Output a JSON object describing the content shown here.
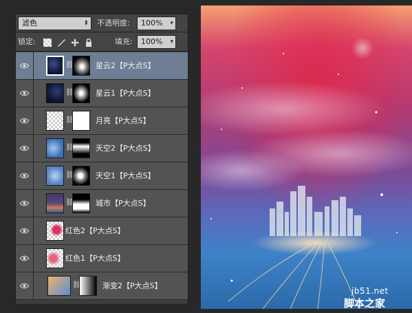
{
  "blend_mode": {
    "value": "滤色"
  },
  "opacity": {
    "label": "不透明度:",
    "value": "100%"
  },
  "lock": {
    "label": "锁定:"
  },
  "fill": {
    "label": "填充:",
    "value": "100%"
  },
  "layers": [
    {
      "name": "星云2【P大点S】",
      "selected": true
    },
    {
      "name": "星云1【P大点S】",
      "selected": false
    },
    {
      "name": "月亮【P大点S】",
      "selected": false
    },
    {
      "name": "天空2【P大点S】",
      "selected": false
    },
    {
      "name": "天空1【P大点S】",
      "selected": false
    },
    {
      "name": "城市【P大点S】",
      "selected": false
    },
    {
      "name": "红色2【P大点S】",
      "selected": false
    },
    {
      "name": "红色1【P大点S】",
      "selected": false
    },
    {
      "name": "渐变2【P大点S】",
      "selected": false
    }
  ],
  "watermark": {
    "url": "jb51.net",
    "site": "脚本之家"
  },
  "colors": {
    "panel_bg": "#535353",
    "selected_bg": "#6e7f95",
    "canvas_top": "#f5a070",
    "canvas_mid": "#b63a70",
    "canvas_bottom": "#2b6aa9"
  }
}
